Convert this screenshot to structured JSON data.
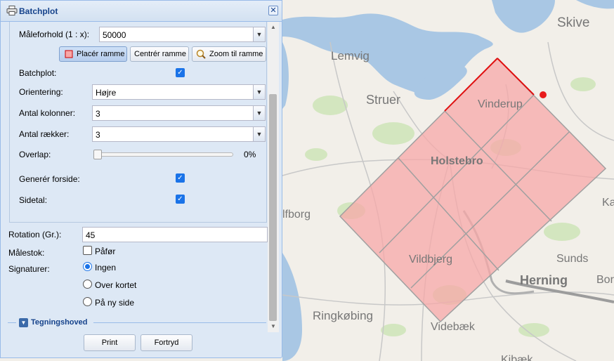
{
  "panel": {
    "title": "Batchplot",
    "close_glyph": "✕"
  },
  "form": {
    "scale_label": "Måleforhold (1 : x):",
    "scale_value": "50000",
    "buttons": {
      "place_frame": "Placér ramme",
      "center_frame": "Centrér ramme",
      "zoom_to_frame": "Zoom til ramme"
    },
    "batchplot_label": "Batchplot:",
    "batchplot_checked": true,
    "orientation_label": "Orientering:",
    "orientation_value": "Højre",
    "columns_label": "Antal kolonner:",
    "columns_value": "3",
    "rows_label": "Antal rækker:",
    "rows_value": "3",
    "overlap_label": "Overlap:",
    "overlap_value": "0%",
    "overlap_fraction": 0,
    "front_page_label": "Generér forside:",
    "front_page_checked": true,
    "page_number_label": "Sidetal:",
    "page_number_checked": true,
    "rotation_label": "Rotation (Gr.):",
    "rotation_value": "45",
    "scalebar_label": "Målestok:",
    "scalebar_option": "Påfør",
    "scalebar_checked": false,
    "signatures_label": "Signaturer:",
    "signature_options": [
      "Ingen",
      "Over kortet",
      "På ny side"
    ],
    "signature_selected": "Ingen",
    "drawing_header_label": "Tegningshoved",
    "print_button": "Print",
    "cancel_button": "Fortryd"
  },
  "map": {
    "place_labels": [
      "Skive",
      "Lemvig",
      "Struer",
      "Vinderup",
      "Holstebro",
      "lfborg",
      "Vildbjerg",
      "Sunds",
      "Herning",
      "Ringkøbing",
      "Videbæk",
      "Ka",
      "Bor",
      "Kibæk"
    ],
    "grid_rows": 3,
    "grid_columns": 3,
    "rotation_degrees": 45,
    "colors": {
      "water": "#a9c7e4",
      "land": "#f2efe9",
      "forest": "#cfe3b8",
      "frame_fill": "#f7a8a8",
      "frame_stroke": "#a0a0a0",
      "frame_top_edge": "#e01010",
      "marker": "#e81c1c"
    }
  },
  "icons": {
    "title_icon": "printer-icon",
    "place_icon": "square-frame-icon",
    "zoom_icon": "magnifier-icon",
    "combo_trigger": "chevron-down-icon"
  }
}
